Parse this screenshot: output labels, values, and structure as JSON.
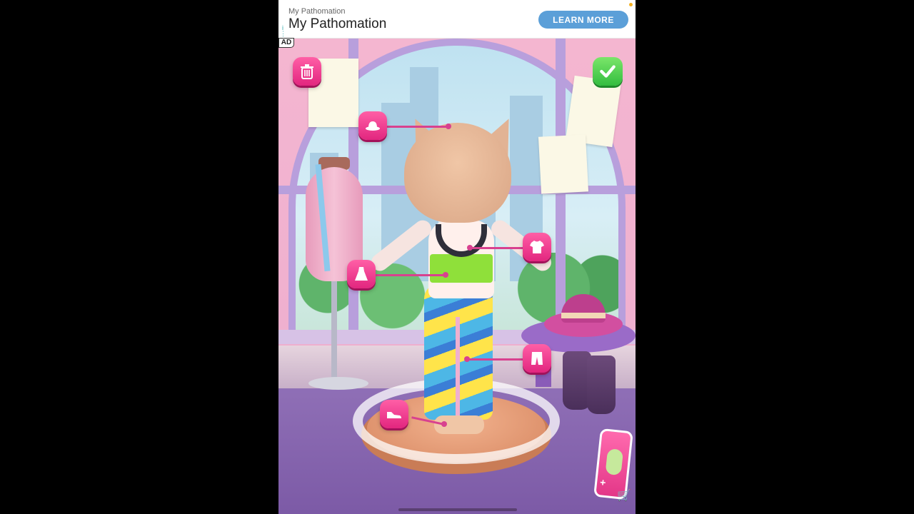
{
  "ad": {
    "sponsor": "My Pathomation",
    "headline": "My Pathomation",
    "cta_label": "LEARN MORE",
    "badge": "AD"
  },
  "game": {
    "buttons": [
      {
        "name": "trash-button",
        "icon": "trash-icon"
      },
      {
        "name": "hat-slot-button",
        "icon": "hat-icon"
      },
      {
        "name": "shirt-slot-button",
        "icon": "tshirt-icon"
      },
      {
        "name": "dress-slot-button",
        "icon": "dress-icon"
      },
      {
        "name": "pants-slot-button",
        "icon": "pants-icon"
      },
      {
        "name": "shoes-slot-button",
        "icon": "sneaker-icon"
      },
      {
        "name": "confirm-button",
        "icon": "checkmark-icon"
      },
      {
        "name": "shop-tag-button",
        "icon": "shopping-cart-icon"
      }
    ],
    "colors": {
      "accent": "#e2267f",
      "confirm": "#33bd3f",
      "ad_cta": "#5b9fd8"
    }
  }
}
